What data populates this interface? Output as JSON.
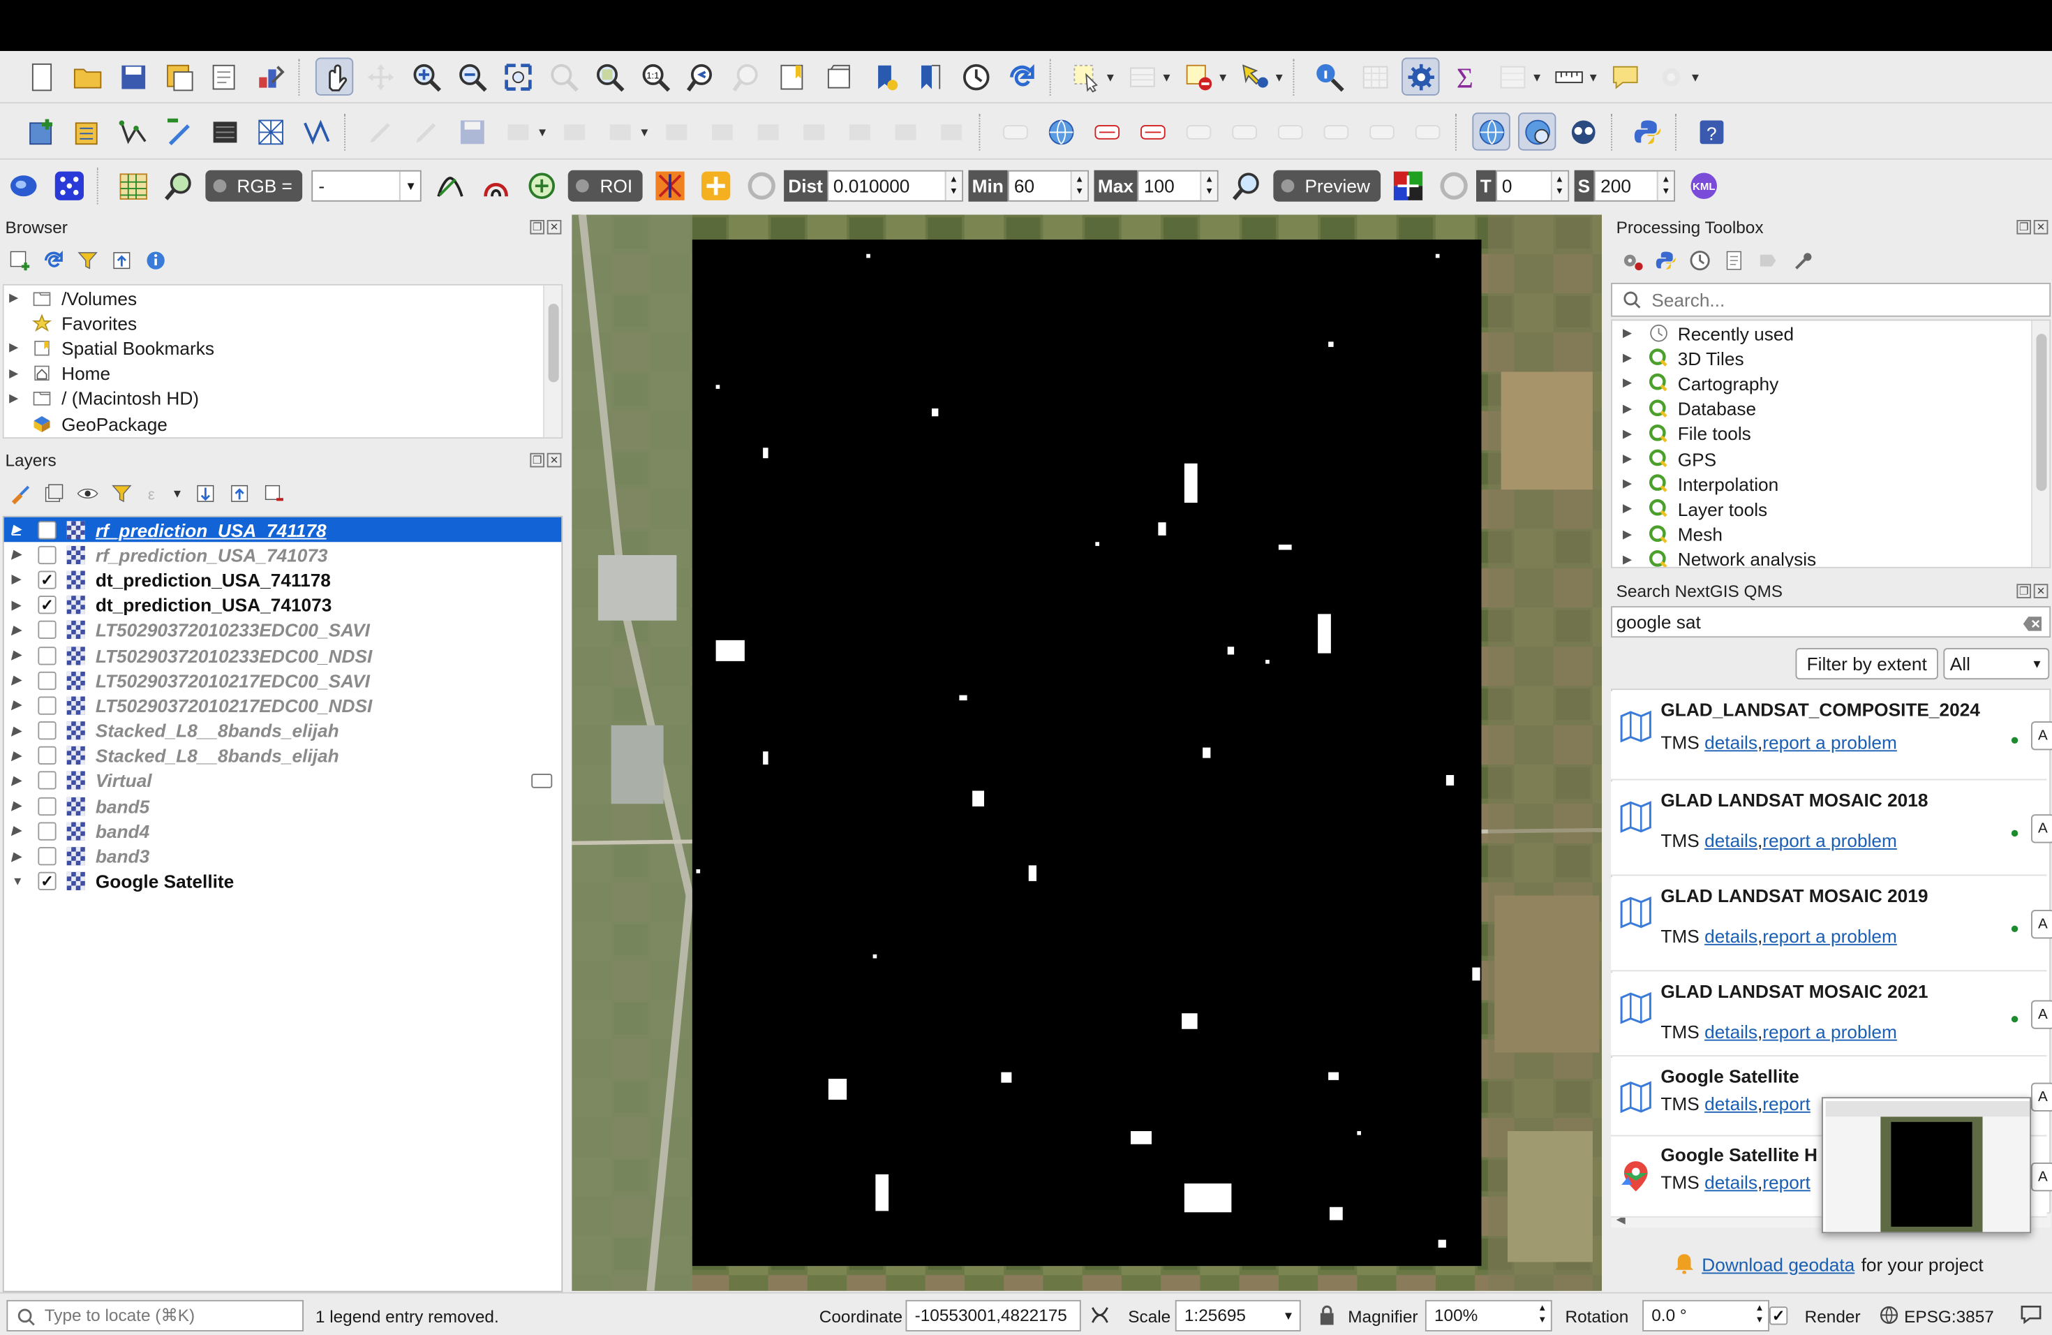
{
  "toolbar3": {
    "rgb_label": "RGB =",
    "rgb_value": "-",
    "roi_label": "ROI",
    "dist_label": "Dist",
    "dist_value": "0.010000",
    "min_label": "Min",
    "min_value": "60",
    "max_label": "Max",
    "max_value": "100",
    "preview_label": "Preview",
    "t_label": "T",
    "t_value": "0",
    "s_label": "S",
    "s_value": "200",
    "kml_label": "KML"
  },
  "browser": {
    "title": "Browser",
    "items": [
      {
        "label": "/Volumes",
        "icon": "folder-icon",
        "expandable": true
      },
      {
        "label": "Favorites",
        "icon": "star-icon",
        "expandable": false
      },
      {
        "label": "Spatial Bookmarks",
        "icon": "bookmark-icon",
        "expandable": true
      },
      {
        "label": "Home",
        "icon": "home-icon",
        "expandable": true
      },
      {
        "label": "/ (Macintosh HD)",
        "icon": "folder-icon",
        "expandable": true
      },
      {
        "label": "GeoPackage",
        "icon": "geopackage-icon",
        "expandable": false
      }
    ]
  },
  "layers": {
    "title": "Layers",
    "items": [
      {
        "label": "rf_prediction_USA_741178",
        "checked": false,
        "selected": true,
        "visible": false,
        "expanded": false
      },
      {
        "label": "rf_prediction_USA_741073",
        "checked": false,
        "selected": false,
        "visible": false,
        "expanded": false
      },
      {
        "label": "dt_prediction_USA_741178",
        "checked": true,
        "selected": false,
        "visible": true,
        "expanded": false
      },
      {
        "label": "dt_prediction_USA_741073",
        "checked": true,
        "selected": false,
        "visible": true,
        "expanded": false
      },
      {
        "label": "LT50290372010233EDC00_SAVI",
        "checked": false,
        "selected": false,
        "visible": false,
        "expanded": false
      },
      {
        "label": "LT50290372010233EDC00_NDSI",
        "checked": false,
        "selected": false,
        "visible": false,
        "expanded": false
      },
      {
        "label": "LT50290372010217EDC00_SAVI",
        "checked": false,
        "selected": false,
        "visible": false,
        "expanded": false
      },
      {
        "label": "LT50290372010217EDC00_NDSI",
        "checked": false,
        "selected": false,
        "visible": false,
        "expanded": false
      },
      {
        "label": "Stacked_L8__8bands_elijah",
        "checked": false,
        "selected": false,
        "visible": false,
        "expanded": false
      },
      {
        "label": "Stacked_L8__8bands_elijah",
        "checked": false,
        "selected": false,
        "visible": false,
        "expanded": false
      },
      {
        "label": "Virtual",
        "checked": false,
        "selected": false,
        "visible": false,
        "expanded": false
      },
      {
        "label": "band5",
        "checked": false,
        "selected": false,
        "visible": false,
        "expanded": false
      },
      {
        "label": "band4",
        "checked": false,
        "selected": false,
        "visible": false,
        "expanded": false
      },
      {
        "label": "band3",
        "checked": false,
        "selected": false,
        "visible": false,
        "expanded": false
      },
      {
        "label": "Google Satellite",
        "checked": true,
        "selected": false,
        "visible": true,
        "expanded": true
      }
    ]
  },
  "processing": {
    "title": "Processing Toolbox",
    "search_placeholder": "Search...",
    "items": [
      "Recently used",
      "3D Tiles",
      "Cartography",
      "Database",
      "File tools",
      "GPS",
      "Interpolation",
      "Layer tools",
      "Mesh",
      "Network analysis"
    ]
  },
  "qms": {
    "title": "Search NextGIS QMS",
    "search_value": "google sat",
    "filter_button": "Filter by extent",
    "filter_option": "All",
    "type_label": "TMS",
    "details_link": "details",
    "report_link": "report a problem",
    "report_short": "report",
    "add_label": "A",
    "results": [
      {
        "name": "GLAD_LANDSAT_COMPOSITE_2024",
        "type": "TMS"
      },
      {
        "name": "GLAD LANDSAT MOSAIC 2018",
        "type": "TMS"
      },
      {
        "name": "GLAD LANDSAT MOSAIC 2019",
        "type": "TMS"
      },
      {
        "name": "GLAD LANDSAT MOSAIC 2021",
        "type": "TMS"
      },
      {
        "name": "Google Satellite",
        "type": "TMS"
      },
      {
        "name": "Google Satellite H",
        "type": "TMS"
      }
    ],
    "footer_link": "Download geodata",
    "footer_text": "for your project"
  },
  "statusbar": {
    "locate_placeholder": "Type to locate (⌘K)",
    "message": "1 legend entry removed.",
    "coordinate_label": "Coordinate",
    "coordinate_value": "-10553001,4822175",
    "scale_label": "Scale",
    "scale_value": "1:25695",
    "magnifier_label": "Magnifier",
    "magnifier_value": "100%",
    "rotation_label": "Rotation",
    "rotation_value": "0.0 °",
    "render_label": "Render",
    "render_checked": true,
    "crs_label": "EPSG:3857"
  },
  "colors": {
    "selection": "#1264d6",
    "link": "#1a5fb4",
    "window_bg": "#ececec",
    "raster_black": "#000000"
  }
}
